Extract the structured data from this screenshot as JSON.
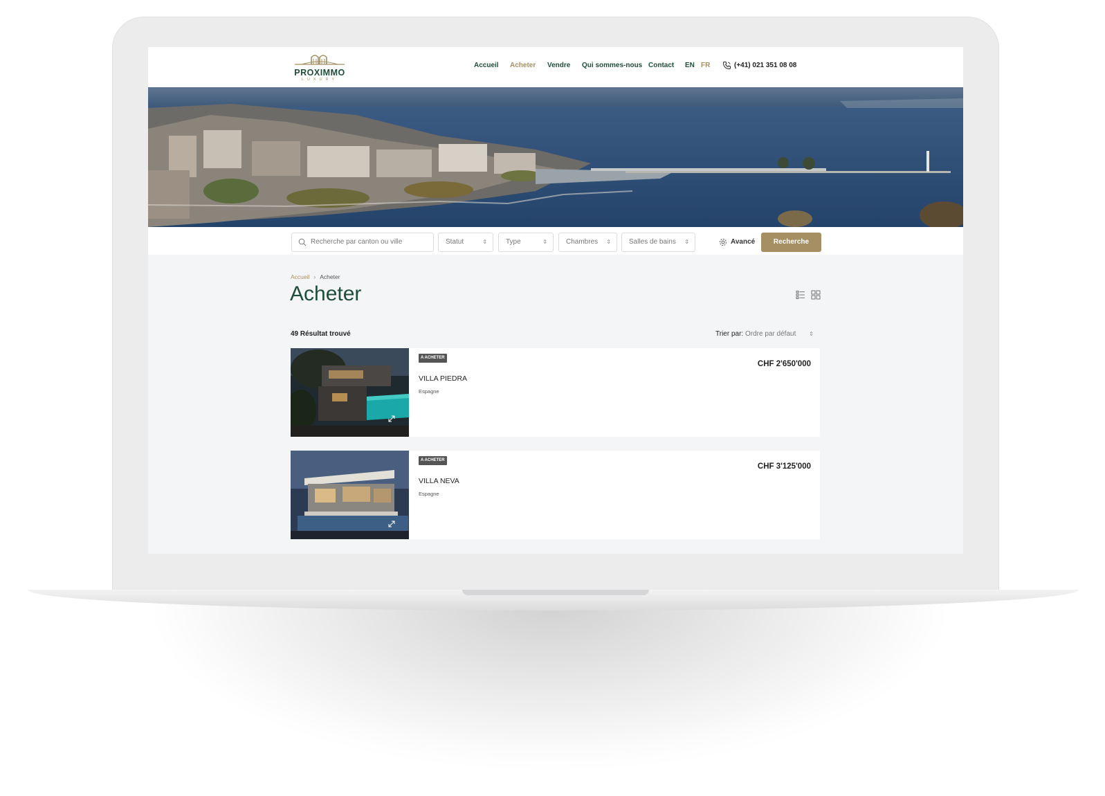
{
  "brand": {
    "name": "PROXIMMO",
    "tagline": "LUXURY",
    "gold": "#a58f63",
    "green": "#1f4d39"
  },
  "nav": {
    "items": [
      {
        "label": "Accueil",
        "active": false
      },
      {
        "label": "Acheter",
        "active": true
      },
      {
        "label": "Vendre",
        "active": false
      },
      {
        "label": "Qui sommes-nous",
        "active": false
      },
      {
        "label": "Contact",
        "active": false
      }
    ],
    "lang_en": "EN",
    "lang_fr": "FR",
    "phone": "(+41) 021 351 08 08"
  },
  "search": {
    "placeholder": "Recherche par canton ou ville",
    "filters": [
      "Statut",
      "Type",
      "Chambres",
      "Salles de bains"
    ],
    "advanced_label": "Avancé",
    "submit_label": "Recherche"
  },
  "breadcrumb": {
    "home": "Accueil",
    "current": "Acheter"
  },
  "page": {
    "title": "Acheter",
    "results_count": "49 Résultat trouvé",
    "sort_label": "Trier par:",
    "sort_value": "Ordre par défaut"
  },
  "listings": [
    {
      "badge": "A ACHETER",
      "name": "VILLA PIEDRA",
      "location": "Espagne",
      "price": "CHF 2'650'000"
    },
    {
      "badge": "A ACHETER",
      "name": "VILLA NEVA",
      "location": "Espagne",
      "price": "CHF 3'125'000"
    }
  ],
  "icons": {
    "phone": "phone-icon",
    "search": "search-icon",
    "gear": "gear-icon",
    "list_view": "list-view-icon",
    "grid_view": "grid-view-icon",
    "expand": "expand-icon"
  }
}
